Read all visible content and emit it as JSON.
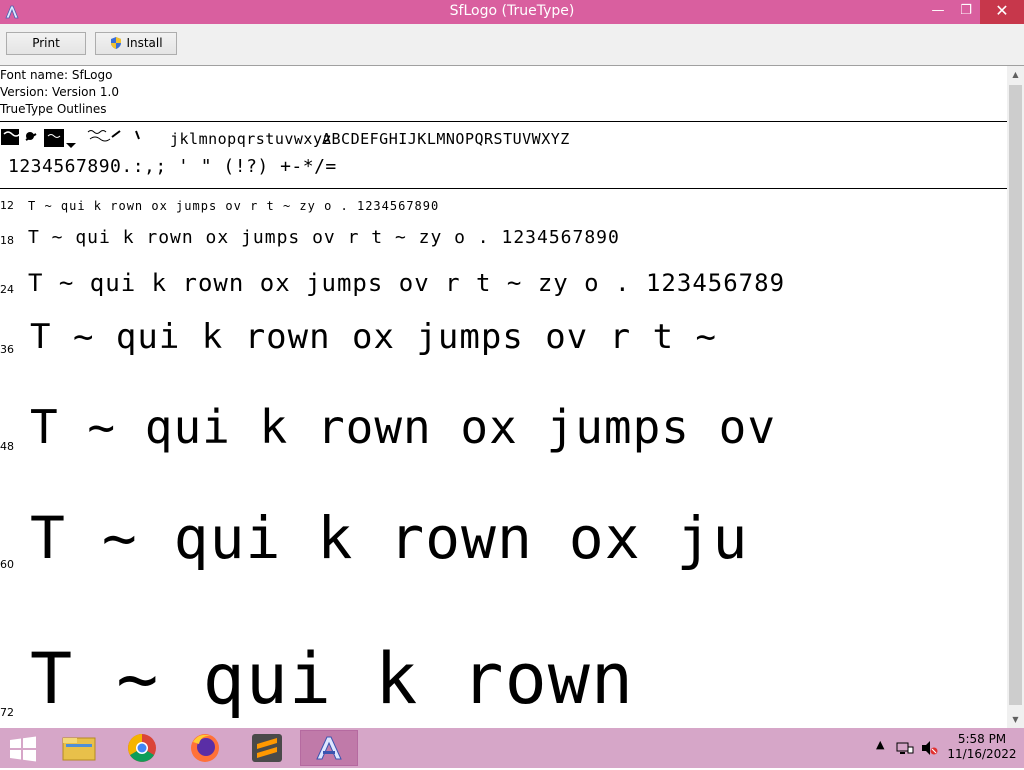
{
  "window": {
    "title": "SfLogo (TrueType)",
    "minimize_glyph": "—",
    "maximize_glyph": "❐",
    "close_glyph": "✕"
  },
  "toolbar": {
    "print_label": "Print",
    "install_label": "Install"
  },
  "font_info": {
    "name_line": "Font name: SfLogo",
    "version_line": "Version: Version 1.0",
    "type_line": "TrueType Outlines"
  },
  "glyph_rows": {
    "row1_lowercase": "jklmnopqrstuvwxyz",
    "row1_uppercase": "ABCDEFGHIJKLMNOPQRSTUVWXYZ",
    "row2_symbols": "1234567890.:,; ' \" (!?) +-*/="
  },
  "samples": [
    {
      "size": "12",
      "text": "T ~ qui k rown ox jumps ov r t ~ zy o . 1234567890"
    },
    {
      "size": "18",
      "text": "T ~ qui k rown ox jumps ov r t ~ zy o . 1234567890"
    },
    {
      "size": "24",
      "text": "T ~ qui k rown ox jumps ov r t ~ zy o . 123456789"
    },
    {
      "size": "36",
      "text": "T ~ qui k rown ox jumps ov r t ~"
    },
    {
      "size": "48",
      "text": "T ~ qui k rown ox jumps ov"
    },
    {
      "size": "60",
      "text": "T ~ qui k rown ox ju"
    },
    {
      "size": "72",
      "text": "T ~ qui k rown"
    }
  ],
  "taskbar": {
    "apps": [
      "file-explorer",
      "chrome",
      "firefox",
      "sublime-text",
      "font-viewer"
    ],
    "tray_icons": [
      "tray-overflow-icon",
      "network-icon",
      "volume-muted-icon"
    ]
  },
  "clock": {
    "time": "5:58 PM",
    "date": "11/16/2022"
  },
  "colors": {
    "titlebar": "#d95f9f",
    "close_button": "#c7374b",
    "taskbar": "#d6a6c8",
    "active_task": "#c07aa9"
  }
}
